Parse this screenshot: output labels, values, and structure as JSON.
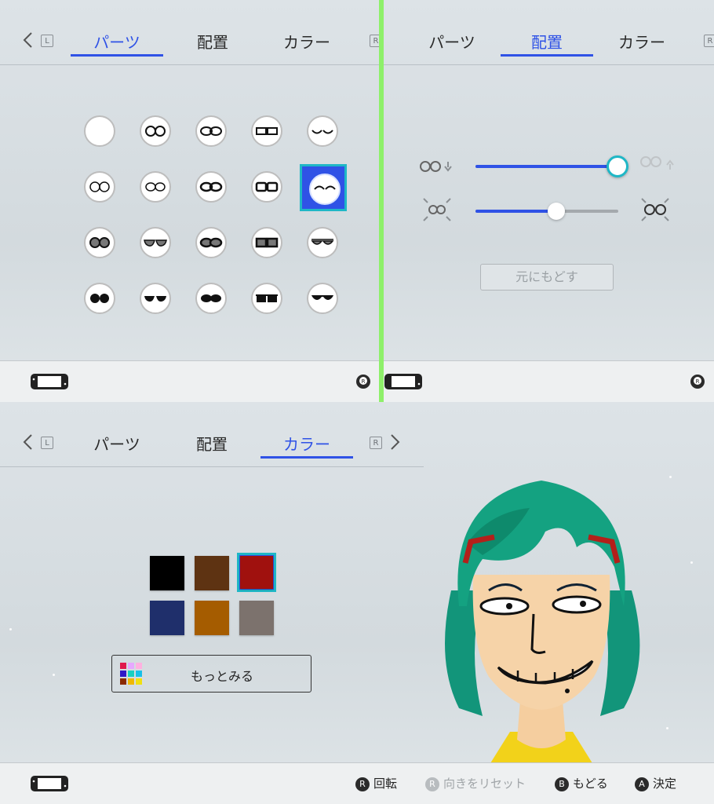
{
  "tabs": {
    "parts": "パーツ",
    "position": "配置",
    "color": "カラー",
    "l_button": "L",
    "r_button": "R"
  },
  "top_left": {
    "active_tab": "parts",
    "selected_glasses": "row2-col5"
  },
  "top_right": {
    "active_tab": "position",
    "size_slider_value": 1.0,
    "vertical_slider_value": 0.57,
    "reset_label": "元にもどす"
  },
  "bottom": {
    "active_tab": "color",
    "swatches": [
      {
        "color": "#000000"
      },
      {
        "color": "#5e3312"
      },
      {
        "color": "#a0110e",
        "selected": true
      },
      {
        "color": "#1f2f6b"
      },
      {
        "color": "#a55c00"
      },
      {
        "color": "#7c726d"
      }
    ],
    "more_label": "もっとみる",
    "footer": {
      "rotate": "回転",
      "reset_direction": "向きをリセット",
      "back": "もどる",
      "confirm": "決定",
      "b_button": "B",
      "a_button": "A",
      "r_button": "R"
    }
  },
  "colors": {
    "accent": "#2f52e6",
    "selection_border": "#1fb7c6",
    "divider": "#8ef06a"
  }
}
